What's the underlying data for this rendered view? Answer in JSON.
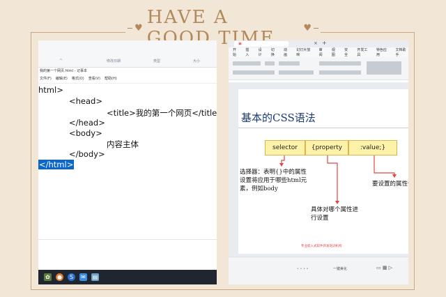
{
  "banner": {
    "title": "HAVE A GOOD TIME"
  },
  "left_window": {
    "explorer_columns": [
      "修改日期",
      "类型",
      "大小"
    ],
    "notepad_title": "我的第一个网页.html - 记事本",
    "menu": [
      "文件(F)",
      "编辑(E)",
      "格式(O)",
      "查看(V)",
      "帮助(H)"
    ],
    "code_lines": [
      "html>",
      "<head>",
      "<title>我的第一个网页</title>",
      "</head>",
      "<body>",
      "内容主体",
      "</body>",
      "</html>"
    ]
  },
  "right_window": {
    "ribbon_tabs": [
      "开始",
      "插入",
      "设计",
      "切换",
      "动画",
      "幻灯片放映",
      "审阅",
      "视图",
      "安全",
      "开发工具",
      "特色应用",
      "文档助手"
    ],
    "slide": {
      "title": "基本的CSS语法",
      "boxes": [
        "selector",
        "{property",
        ":value;}"
      ],
      "annotation_selector": [
        "选择器：表明{}中的属性",
        "设置将应用于哪些html元",
        "素，例如body"
      ],
      "annotation_property": [
        "具体对哪个属性进",
        "行设置"
      ],
      "annotation_value": "要设置的属性值",
      "footer": "专业嵌入式软件开发培训机构"
    },
    "statusbar_zoom": "一键美化"
  },
  "colors": {
    "background": "#f2e6d6",
    "accent": "#b08a5c",
    "slide_title": "#1c3a78",
    "box_fill": "#fdf2a8",
    "arrow": "#e04646"
  }
}
